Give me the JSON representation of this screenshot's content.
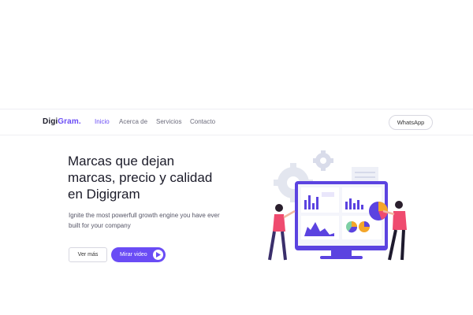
{
  "brand": {
    "name_part1": "Digi",
    "name_part2": "Gram."
  },
  "nav": {
    "links": [
      {
        "label": "Inicio",
        "active": true
      },
      {
        "label": "Acerca de",
        "active": false
      },
      {
        "label": "Servicios",
        "active": false
      },
      {
        "label": "Contacto",
        "active": false
      }
    ],
    "whatsapp_label": "WhatsApp"
  },
  "hero": {
    "title_lines": [
      "Marcas que dejan",
      "marcas, precio y calidad",
      "en Digigram"
    ],
    "subtitle_lines": [
      "Ignite the most powerfull growth engine you have ever",
      "built for your company"
    ],
    "more_label": "Ver más",
    "video_label": "Mirar video"
  },
  "colors": {
    "accent": "#6a4cf5",
    "text": "#1b1b29",
    "muted": "#555566",
    "border": "#d7d7e0"
  },
  "icons": {
    "play": "play-icon",
    "gear": "gear-icon"
  }
}
